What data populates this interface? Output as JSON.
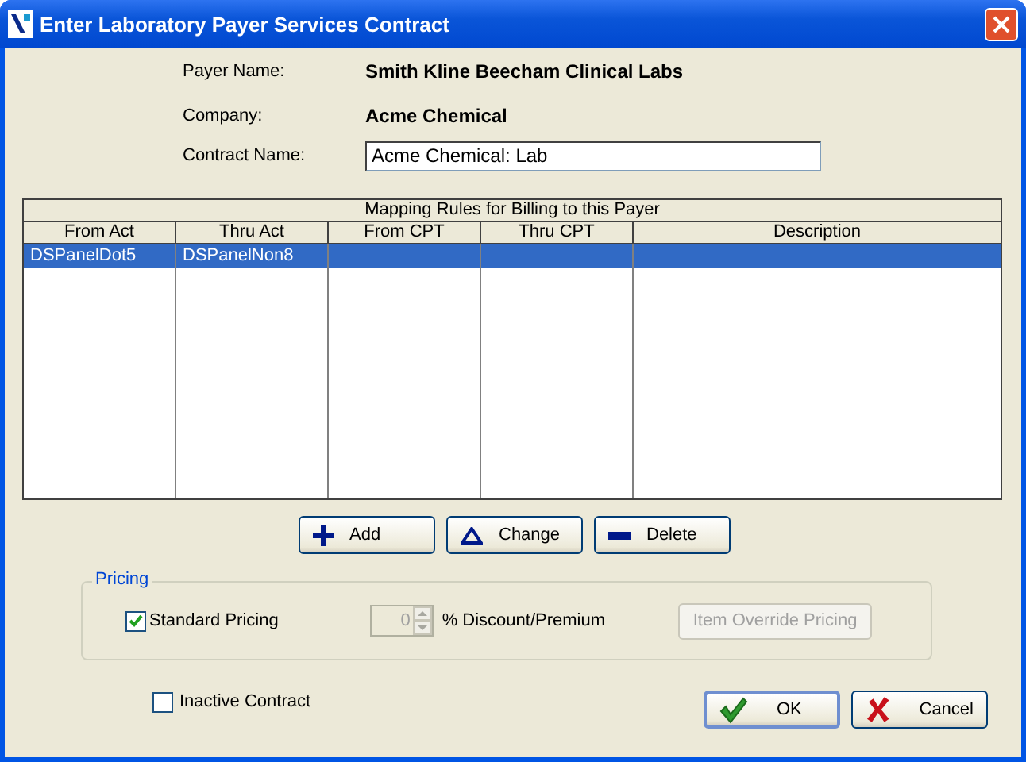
{
  "window": {
    "title": "Enter Laboratory Payer Services Contract"
  },
  "payer_name": {
    "label": "Payer Name:",
    "value": "Smith Kline Beecham Clinical Labs"
  },
  "company": {
    "label": "Company:",
    "value": "Acme Chemical"
  },
  "contract_name": {
    "label": "Contract Name:",
    "value": "Acme Chemical: Lab"
  },
  "mapping_table": {
    "title": "Mapping Rules for Billing to this Payer",
    "columns": [
      "From Act",
      "Thru Act",
      "From CPT",
      "Thru CPT",
      "Description"
    ],
    "rows": [
      {
        "cells": [
          "DSPanelDot5",
          "DSPanelNon8",
          "",
          "",
          ""
        ],
        "selected": true
      }
    ]
  },
  "row_buttons": [
    {
      "kind": "add",
      "label": "Add"
    },
    {
      "kind": "change",
      "label": "Change"
    },
    {
      "kind": "delete",
      "label": "Delete"
    }
  ],
  "pricing": {
    "title": "Pricing",
    "standard_pricing": {
      "label": "Standard Pricing",
      "checked": true
    },
    "discount": {
      "value": "0",
      "label": "% Discount/Premium",
      "disabled": true
    },
    "override_button": {
      "label": "Item Override Pricing",
      "disabled": true
    }
  },
  "inactive_contract": {
    "label": "Inactive Contract",
    "checked": false
  },
  "dialog_buttons": [
    {
      "kind": "ok",
      "label": "OK"
    },
    {
      "kind": "cancel",
      "label": "Cancel"
    }
  ]
}
